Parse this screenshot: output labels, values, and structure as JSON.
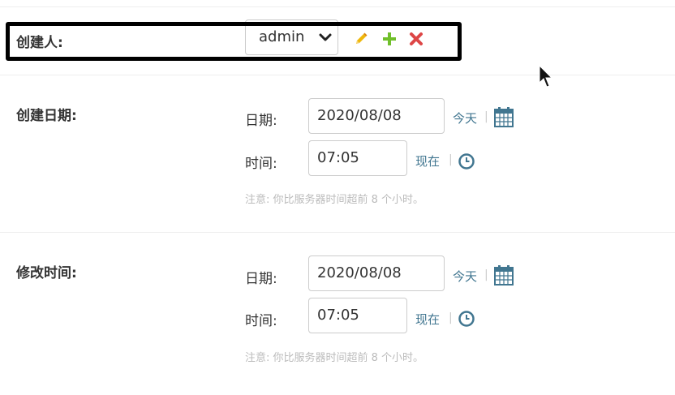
{
  "creator": {
    "label": "创建人:",
    "selected": "admin",
    "actions": [
      "pencil-icon",
      "plus-icon",
      "delete-x-icon"
    ]
  },
  "created_date": {
    "label": "创建日期:",
    "date_label": "日期:",
    "date_value": "2020/08/08",
    "today_link": "今天",
    "time_label": "时间:",
    "time_value": "07:05",
    "now_link": "现在",
    "help": "注意: 你比服务器时间超前 8 个小时。"
  },
  "modified_time": {
    "label": "修改时间:",
    "date_label": "日期:",
    "date_value": "2020/08/08",
    "today_link": "今天",
    "time_label": "时间:",
    "time_value": "07:05",
    "now_link": "现在",
    "help": "注意: 你比服务器时间超前 8 个小时。"
  },
  "colors": {
    "link": "#417690",
    "pencil": "#efb80b",
    "plus": "#70bf2b",
    "delete": "#dd4646",
    "help_text": "#bbbbbb"
  },
  "separator": "|"
}
